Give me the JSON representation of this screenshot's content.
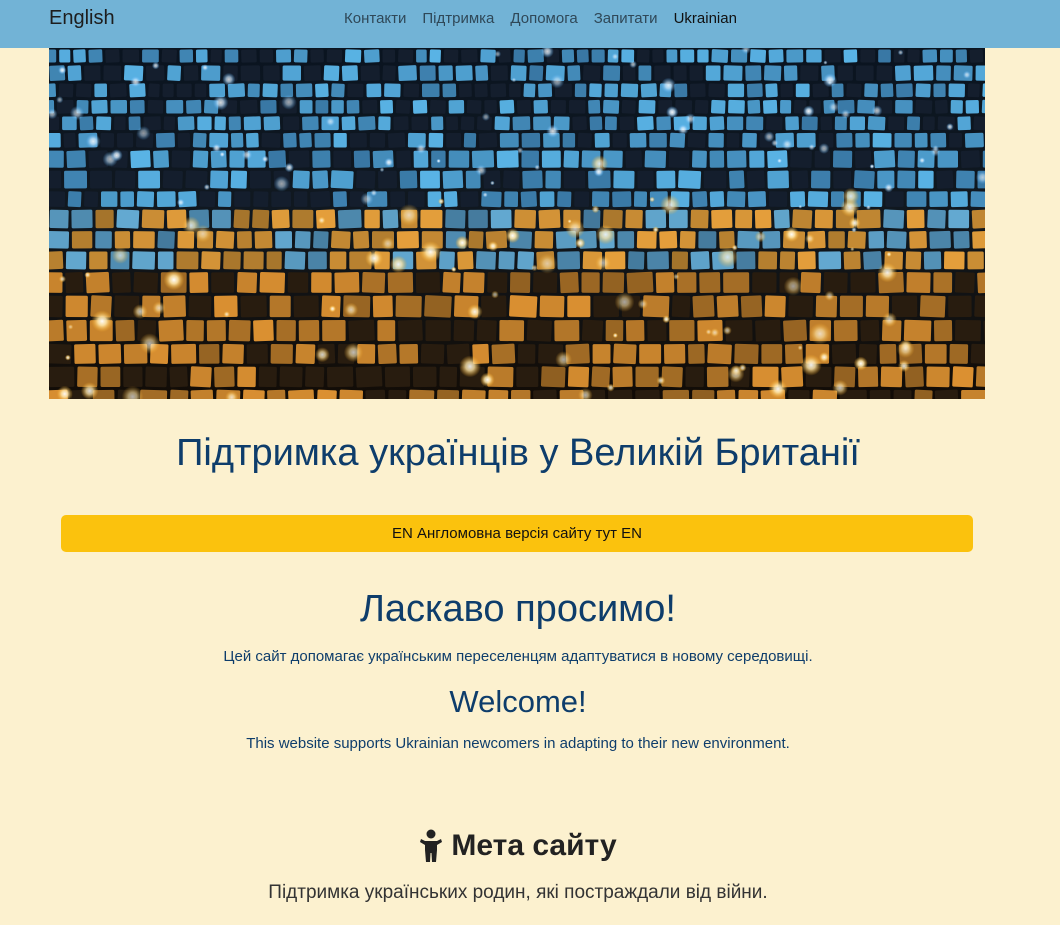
{
  "navbar": {
    "brand": "English",
    "links": [
      {
        "label": "Контакти"
      },
      {
        "label": "Підтримка"
      },
      {
        "label": "Допомога"
      },
      {
        "label": "Запитати"
      },
      {
        "label": "Ukrainian",
        "active": true
      }
    ]
  },
  "hero": {
    "image": "mosaic-lights-hero-image"
  },
  "page": {
    "title": "Підтримка українців у Великій Британії",
    "english_banner": "EN Англомовна версія сайту тут EN",
    "welcome_uk_heading": "Ласкаво просимо!",
    "welcome_uk_text": "Цей сайт допомагає українським переселенцям адаптуватися в новому середовищі.",
    "welcome_en_heading": "Welcome!",
    "welcome_en_text": "This website supports Ukrainian newcomers in adapting to their new environment.",
    "goal_heading": "Мета сайту",
    "goal_icon": "child-icon",
    "goal_text": "Підтримка українських родин, які постраждали від війни."
  },
  "colors": {
    "navbar": "#72b3d6",
    "background": "#fcf1cf",
    "heading": "#0e3d6b",
    "banner": "#fbc20d"
  }
}
